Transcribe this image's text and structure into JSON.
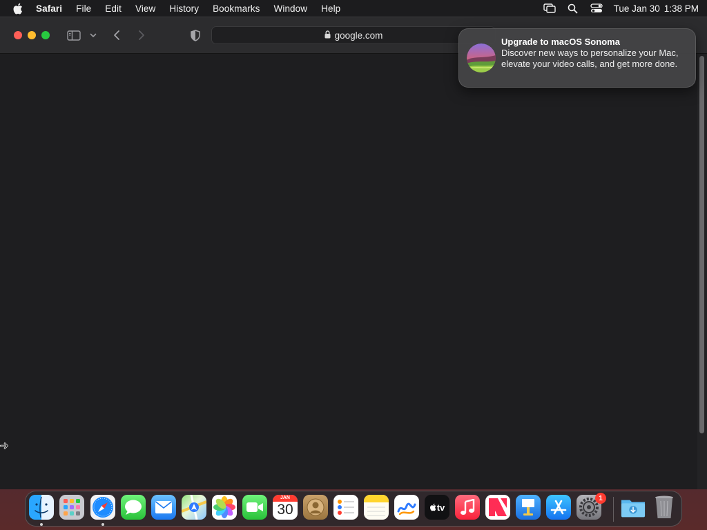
{
  "menubar": {
    "app_name": "Safari",
    "items": [
      "File",
      "Edit",
      "View",
      "History",
      "Bookmarks",
      "Window",
      "Help"
    ],
    "date": "Tue Jan 30",
    "time": "1:38 PM"
  },
  "toolbar": {
    "url": "google.com"
  },
  "notification": {
    "title": "Upgrade to macOS Sonoma",
    "body": "Discover new ways to personalize your Mac, elevate your video calls, and get more done."
  },
  "dock": {
    "calendar_month": "JAN",
    "calendar_day": "30",
    "appletv_label": "tv",
    "settings_badge": "1"
  },
  "colors": {
    "close": "#ff5f57",
    "minimize": "#febc2e",
    "maximize": "#28c840",
    "badge": "#ff3b30"
  }
}
